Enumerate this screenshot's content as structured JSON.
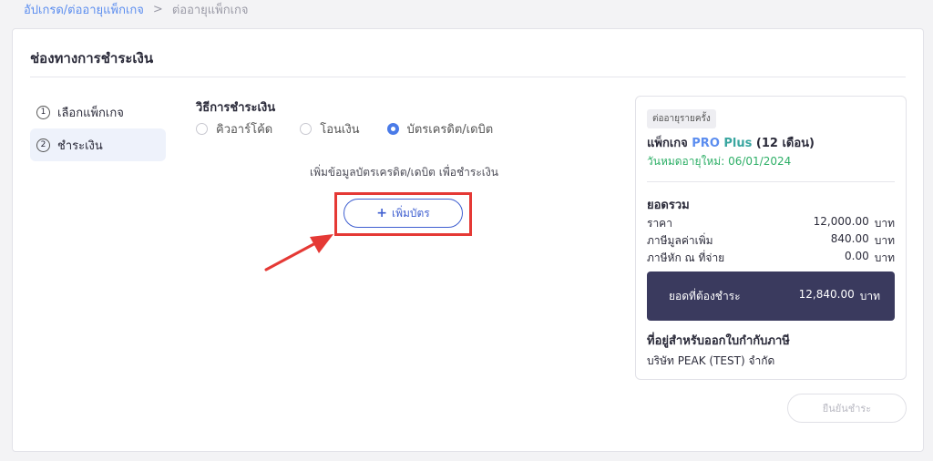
{
  "breadcrumb": {
    "link": "อัปเกรด/ต่ออายุแพ็กเกจ",
    "separator": ">",
    "current": "ต่ออายุแพ็กเกจ"
  },
  "card": {
    "title": "ช่องทางการชำระเงิน"
  },
  "steps": [
    {
      "number": "1",
      "label": "เลือกแพ็กเกจ"
    },
    {
      "number": "2",
      "label": "ชำระเงิน"
    }
  ],
  "payment": {
    "title": "วิธีการชำระเงิน",
    "options": [
      "คิวอาร์โค้ด",
      "โอนเงิน",
      "บัตรเครดิต/เดบิต"
    ],
    "selected": "บัตรเครดิต/เดบิต",
    "add_hint": "เพิ่มข้อมูลบัตรเครดิต/เดบิต เพื่อชำระเงิน",
    "add_card_label": "เพิ่มบัตร"
  },
  "summary": {
    "badge": "ต่ออายุรายครั้ง",
    "package_prefix": "แพ็กเกจ ",
    "package_pro": "PRO",
    "package_plus": " Plus",
    "package_suffix": " (12 เดือน)",
    "expiry": "วันหมดอายุใหม่: 06/01/2024",
    "total_title": "ยอดรวม",
    "rows": [
      {
        "label": "ราคา",
        "amount": "12,000.00",
        "unit": "บาท"
      },
      {
        "label": "ภาษีมูลค่าเพิ่ม",
        "amount": "840.00",
        "unit": "บาท"
      },
      {
        "label": "ภาษีหัก ณ ที่จ่าย",
        "amount": "0.00",
        "unit": "บาท"
      }
    ],
    "due_label": "ยอดที่ต้องชำระ",
    "due_amount": "12,840.00",
    "due_unit": "บาท",
    "address_title": "ที่อยู่สำหรับออกใบกำกับภาษี",
    "address_value": "บริษัท PEAK (TEST) จำกัด"
  },
  "confirm_label": "ยืนยันชำระ",
  "colors": {
    "accent": "#4a7be8",
    "highlight": "#e53935",
    "due_bg": "#3a3a5e",
    "expiry": "#2eaf67"
  }
}
